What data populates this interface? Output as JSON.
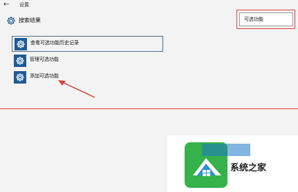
{
  "window": {
    "title": "设置",
    "back_icon": "back-arrow-icon"
  },
  "header": {
    "label": "搜索结果",
    "icon": "gear-icon"
  },
  "search": {
    "value": "可选功能"
  },
  "results": [
    {
      "label": "查看可选功能历史记录",
      "icon": "gear-icon",
      "selected": true
    },
    {
      "label": "管理可选功能",
      "icon": "gear-icon",
      "selected": false
    },
    {
      "label": "添加可选功能",
      "icon": "gear-icon",
      "selected": false
    }
  ],
  "annotations": {
    "highlight_color": "#d9423a"
  },
  "watermark": {
    "text": "系统之家",
    "logo": "windows-house-logo"
  },
  "colors": {
    "tile": "#1f5a96",
    "background": "#f3f3f3"
  }
}
